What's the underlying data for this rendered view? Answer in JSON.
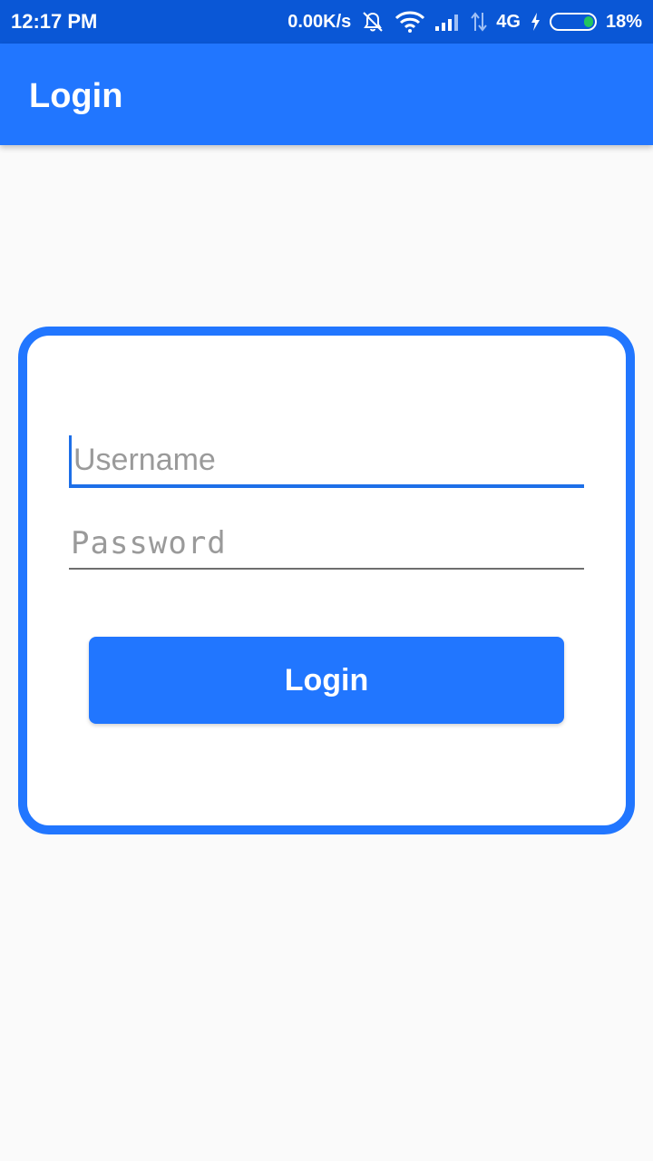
{
  "status_bar": {
    "time": "12:17 PM",
    "network_speed": "0.00K/s",
    "network_type": "4G",
    "battery": "18%",
    "icons": [
      "mute-icon",
      "wifi-icon",
      "signal-icon",
      "data-arrows-icon",
      "charging-icon",
      "battery-icon"
    ]
  },
  "app_bar": {
    "title": "Login"
  },
  "form": {
    "username": {
      "value": "",
      "placeholder": "Username"
    },
    "password": {
      "value": "",
      "placeholder": "Password"
    },
    "login_label": "Login"
  },
  "colors": {
    "accent": "#2176ff",
    "status_bar": "#0a57d6",
    "background": "#fafafa",
    "battery_fill": "#22c55e"
  }
}
